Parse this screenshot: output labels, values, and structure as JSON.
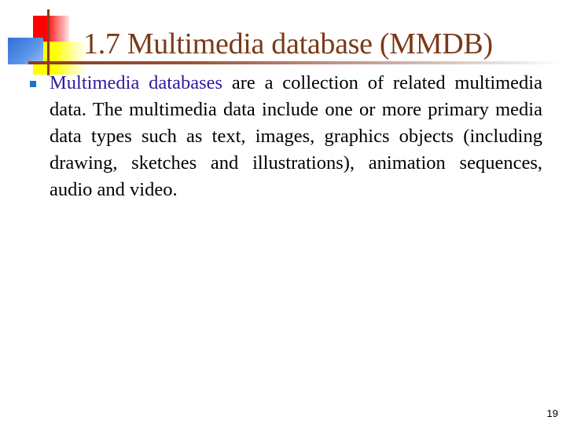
{
  "slide": {
    "title": "1.7 Multimedia database (MMDB)",
    "bullets": [
      {
        "highlight": "Multimedia databases",
        "text": " are a collection of related multimedia data. The multimedia data include one or more primary media data types such as text, images, graphics objects (including drawing, sketches and illustrations), animation sequences, audio and video."
      }
    ],
    "page_number": "19"
  },
  "colors": {
    "title": "#7a3a18",
    "highlight": "#2b1c9e",
    "bullet": "#1f6fd6",
    "logo_red": "#ff0000",
    "logo_yellow": "#ffff00",
    "logo_blue": "#2f6fd8",
    "logo_line": "#8b3a1e"
  },
  "icons": {
    "logo": "colored-squares-logo-icon",
    "bullet": "square-bullet-icon"
  }
}
